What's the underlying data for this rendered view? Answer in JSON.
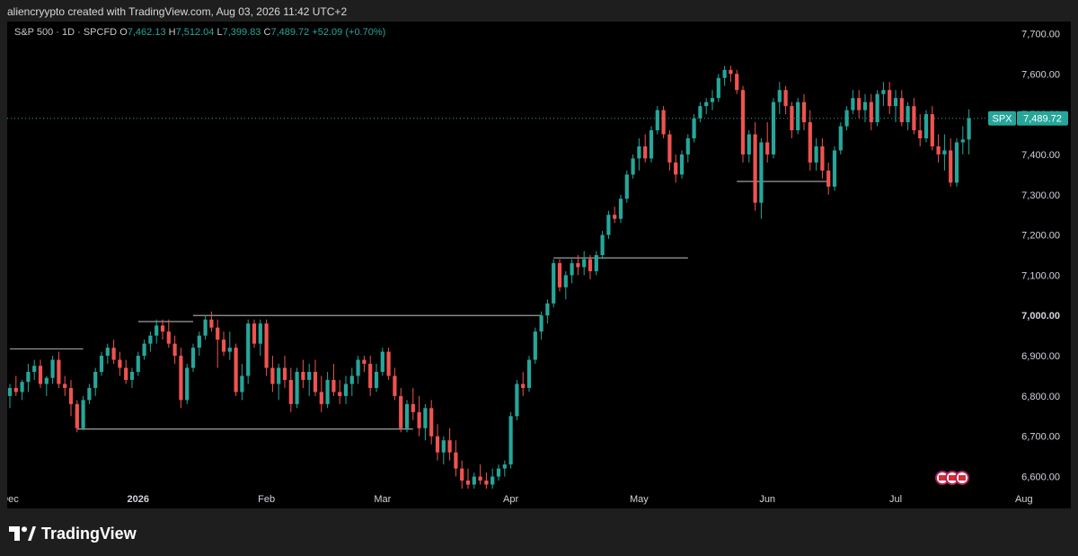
{
  "header": {
    "credit": "aliencryypto created with TradingView.com, Aug 03, 2026 11:42 UTC+2"
  },
  "legend": {
    "symbol": "S&P 500 · 1D · SPCFD",
    "o_label": "O",
    "o": "7,462.13",
    "h_label": "H",
    "h": "7,512.04",
    "l_label": "L",
    "l": "7,399.83",
    "c_label": "C",
    "c": "7,489.72",
    "change": "+52.09 (+0.70%)"
  },
  "footer": {
    "brand": "TradingView"
  },
  "colors": {
    "up": "#26a69a",
    "down": "#ef5350",
    "background": "#000000",
    "axis_text": "#d1d4dc",
    "levels": "#9e9e9e"
  },
  "chart_data": {
    "type": "candlestick",
    "title": "S&P 500 · 1D · SPCFD",
    "ylim": [
      6570,
      7730
    ],
    "y_ticks": [
      6600,
      6700,
      6800,
      6900,
      7000,
      7100,
      7200,
      7300,
      7400,
      7500,
      7600,
      7700
    ],
    "y_tick_labels": [
      "6,600.00",
      "6,700.00",
      "6,800.00",
      "6,900.00",
      "7,000.00",
      "7,100.00",
      "7,200.00",
      "7,300.00",
      "7,400.00",
      "7,500.00",
      "7,600.00",
      "7,700.00"
    ],
    "highlighted_tick": "7,000.00",
    "x_tick_labels": [
      {
        "label": "Dec",
        "index": 0
      },
      {
        "label": "2026",
        "index": 21
      },
      {
        "label": "Feb",
        "index": 42
      },
      {
        "label": "Mar",
        "index": 61
      },
      {
        "label": "Apr",
        "index": 82
      },
      {
        "label": "May",
        "index": 103
      },
      {
        "label": "Jun",
        "index": 124
      },
      {
        "label": "Jul",
        "index": 145
      },
      {
        "label": "Aug",
        "index": 166
      }
    ],
    "last_price": {
      "label": "SPX",
      "value": 7489.72,
      "text": "7,489.72"
    },
    "candles": [
      [
        6800,
        6830,
        6770,
        6820
      ],
      [
        6820,
        6850,
        6800,
        6810
      ],
      [
        6810,
        6840,
        6790,
        6835
      ],
      [
        6835,
        6880,
        6810,
        6860
      ],
      [
        6860,
        6890,
        6840,
        6875
      ],
      [
        6875,
        6890,
        6820,
        6830
      ],
      [
        6830,
        6850,
        6800,
        6845
      ],
      [
        6845,
        6900,
        6830,
        6890
      ],
      [
        6890,
        6910,
        6820,
        6830
      ],
      [
        6830,
        6850,
        6800,
        6820
      ],
      [
        6820,
        6840,
        6750,
        6780
      ],
      [
        6780,
        6790,
        6710,
        6720
      ],
      [
        6720,
        6800,
        6715,
        6790
      ],
      [
        6790,
        6830,
        6780,
        6820
      ],
      [
        6820,
        6870,
        6800,
        6860
      ],
      [
        6860,
        6910,
        6850,
        6900
      ],
      [
        6900,
        6930,
        6880,
        6920
      ],
      [
        6920,
        6940,
        6880,
        6890
      ],
      [
        6890,
        6910,
        6850,
        6870
      ],
      [
        6870,
        6890,
        6830,
        6840
      ],
      [
        6840,
        6870,
        6820,
        6860
      ],
      [
        6860,
        6910,
        6850,
        6900
      ],
      [
        6900,
        6940,
        6890,
        6930
      ],
      [
        6930,
        6960,
        6910,
        6950
      ],
      [
        6950,
        6990,
        6930,
        6975
      ],
      [
        6975,
        6990,
        6940,
        6960
      ],
      [
        6960,
        6990,
        6920,
        6930
      ],
      [
        6930,
        6950,
        6880,
        6900
      ],
      [
        6900,
        6920,
        6770,
        6790
      ],
      [
        6790,
        6880,
        6780,
        6870
      ],
      [
        6870,
        6930,
        6860,
        6920
      ],
      [
        6920,
        6960,
        6900,
        6950
      ],
      [
        6950,
        7000,
        6940,
        6990
      ],
      [
        6990,
        7010,
        6960,
        6970
      ],
      [
        6970,
        6990,
        6870,
        6940
      ],
      [
        6940,
        6960,
        6900,
        6910
      ],
      [
        6910,
        6960,
        6890,
        6920
      ],
      [
        6920,
        6930,
        6800,
        6810
      ],
      [
        6810,
        6880,
        6790,
        6850
      ],
      [
        6850,
        6990,
        6830,
        6980
      ],
      [
        6980,
        6990,
        6920,
        6930
      ],
      [
        6930,
        6990,
        6900,
        6980
      ],
      [
        6980,
        6990,
        6850,
        6870
      ],
      [
        6870,
        6900,
        6810,
        6830
      ],
      [
        6830,
        6880,
        6790,
        6870
      ],
      [
        6870,
        6900,
        6820,
        6840
      ],
      [
        6840,
        6870,
        6760,
        6780
      ],
      [
        6780,
        6870,
        6770,
        6860
      ],
      [
        6860,
        6890,
        6820,
        6840
      ],
      [
        6840,
        6880,
        6800,
        6860
      ],
      [
        6860,
        6890,
        6800,
        6810
      ],
      [
        6810,
        6850,
        6760,
        6780
      ],
      [
        6780,
        6860,
        6770,
        6840
      ],
      [
        6840,
        6880,
        6800,
        6810
      ],
      [
        6810,
        6840,
        6780,
        6800
      ],
      [
        6800,
        6850,
        6780,
        6830
      ],
      [
        6830,
        6870,
        6800,
        6850
      ],
      [
        6850,
        6900,
        6830,
        6890
      ],
      [
        6890,
        6900,
        6860,
        6880
      ],
      [
        6880,
        6900,
        6800,
        6820
      ],
      [
        6820,
        6880,
        6810,
        6860
      ],
      [
        6860,
        6920,
        6850,
        6910
      ],
      [
        6910,
        6920,
        6840,
        6850
      ],
      [
        6850,
        6870,
        6790,
        6800
      ],
      [
        6800,
        6820,
        6710,
        6720
      ],
      [
        6720,
        6790,
        6710,
        6780
      ],
      [
        6780,
        6820,
        6740,
        6760
      ],
      [
        6760,
        6800,
        6700,
        6720
      ],
      [
        6720,
        6780,
        6690,
        6770
      ],
      [
        6770,
        6790,
        6680,
        6700
      ],
      [
        6700,
        6730,
        6640,
        6660
      ],
      [
        6660,
        6700,
        6630,
        6690
      ],
      [
        6690,
        6720,
        6640,
        6660
      ],
      [
        6660,
        6690,
        6600,
        6620
      ],
      [
        6620,
        6640,
        6570,
        6590
      ],
      [
        6590,
        6620,
        6570,
        6580
      ],
      [
        6580,
        6610,
        6570,
        6600
      ],
      [
        6600,
        6630,
        6580,
        6590
      ],
      [
        6590,
        6610,
        6570,
        6580
      ],
      [
        6580,
        6620,
        6570,
        6600
      ],
      [
        6600,
        6630,
        6590,
        6620
      ],
      [
        6620,
        6640,
        6600,
        6630
      ],
      [
        6630,
        6760,
        6620,
        6750
      ],
      [
        6750,
        6840,
        6740,
        6830
      ],
      [
        6830,
        6860,
        6800,
        6820
      ],
      [
        6820,
        6900,
        6810,
        6890
      ],
      [
        6890,
        6970,
        6880,
        6960
      ],
      [
        6960,
        7010,
        6940,
        7000
      ],
      [
        7000,
        7040,
        6980,
        7030
      ],
      [
        7030,
        7140,
        7020,
        7130
      ],
      [
        7130,
        7140,
        7060,
        7070
      ],
      [
        7070,
        7110,
        7040,
        7100
      ],
      [
        7100,
        7140,
        7080,
        7130
      ],
      [
        7130,
        7150,
        7100,
        7120
      ],
      [
        7120,
        7160,
        7100,
        7140
      ],
      [
        7140,
        7150,
        7090,
        7110
      ],
      [
        7110,
        7160,
        7100,
        7150
      ],
      [
        7150,
        7210,
        7140,
        7200
      ],
      [
        7200,
        7260,
        7190,
        7250
      ],
      [
        7250,
        7270,
        7230,
        7240
      ],
      [
        7240,
        7300,
        7230,
        7290
      ],
      [
        7290,
        7360,
        7280,
        7350
      ],
      [
        7350,
        7400,
        7340,
        7390
      ],
      [
        7390,
        7440,
        7360,
        7420
      ],
      [
        7420,
        7450,
        7380,
        7390
      ],
      [
        7390,
        7470,
        7380,
        7460
      ],
      [
        7460,
        7520,
        7450,
        7510
      ],
      [
        7510,
        7520,
        7440,
        7450
      ],
      [
        7450,
        7460,
        7360,
        7380
      ],
      [
        7380,
        7400,
        7330,
        7350
      ],
      [
        7350,
        7410,
        7340,
        7400
      ],
      [
        7400,
        7450,
        7380,
        7440
      ],
      [
        7440,
        7500,
        7430,
        7490
      ],
      [
        7490,
        7530,
        7480,
        7520
      ],
      [
        7520,
        7540,
        7500,
        7530
      ],
      [
        7530,
        7560,
        7510,
        7540
      ],
      [
        7540,
        7600,
        7530,
        7590
      ],
      [
        7590,
        7620,
        7570,
        7610
      ],
      [
        7610,
        7620,
        7580,
        7600
      ],
      [
        7600,
        7610,
        7550,
        7560
      ],
      [
        7560,
        7570,
        7380,
        7400
      ],
      [
        7400,
        7460,
        7380,
        7450
      ],
      [
        7450,
        7480,
        7260,
        7280
      ],
      [
        7280,
        7440,
        7240,
        7430
      ],
      [
        7430,
        7480,
        7380,
        7400
      ],
      [
        7400,
        7540,
        7390,
        7530
      ],
      [
        7530,
        7580,
        7500,
        7560
      ],
      [
        7560,
        7570,
        7500,
        7520
      ],
      [
        7520,
        7530,
        7440,
        7460
      ],
      [
        7460,
        7540,
        7450,
        7530
      ],
      [
        7530,
        7550,
        7460,
        7480
      ],
      [
        7480,
        7510,
        7360,
        7380
      ],
      [
        7380,
        7440,
        7360,
        7420
      ],
      [
        7420,
        7440,
        7340,
        7360
      ],
      [
        7360,
        7380,
        7300,
        7320
      ],
      [
        7320,
        7420,
        7310,
        7410
      ],
      [
        7410,
        7480,
        7400,
        7470
      ],
      [
        7470,
        7520,
        7460,
        7510
      ],
      [
        7510,
        7560,
        7500,
        7540
      ],
      [
        7540,
        7560,
        7490,
        7510
      ],
      [
        7510,
        7550,
        7480,
        7530
      ],
      [
        7530,
        7550,
        7460,
        7480
      ],
      [
        7480,
        7560,
        7470,
        7550
      ],
      [
        7550,
        7580,
        7520,
        7560
      ],
      [
        7560,
        7580,
        7500,
        7520
      ],
      [
        7520,
        7560,
        7480,
        7540
      ],
      [
        7540,
        7560,
        7470,
        7480
      ],
      [
        7480,
        7530,
        7460,
        7520
      ],
      [
        7520,
        7540,
        7450,
        7460
      ],
      [
        7460,
        7500,
        7420,
        7440
      ],
      [
        7440,
        7510,
        7430,
        7500
      ],
      [
        7500,
        7520,
        7410,
        7420
      ],
      [
        7420,
        7450,
        7380,
        7400
      ],
      [
        7400,
        7450,
        7360,
        7410
      ],
      [
        7410,
        7440,
        7320,
        7330
      ],
      [
        7330,
        7440,
        7320,
        7430
      ],
      [
        7430,
        7470,
        7400,
        7437
      ],
      [
        7437,
        7512,
        7400,
        7490
      ]
    ],
    "levels": [
      {
        "price": 6917,
        "from": 0,
        "to": 12
      },
      {
        "price": 6985,
        "from": 21,
        "to": 30
      },
      {
        "price": 7000,
        "from": 30,
        "to": 87
      },
      {
        "price": 6718,
        "from": 11,
        "to": 66
      },
      {
        "price": 7333,
        "from": 119,
        "to": 134
      },
      {
        "price": 7143,
        "from": 89,
        "to": 111
      }
    ]
  }
}
